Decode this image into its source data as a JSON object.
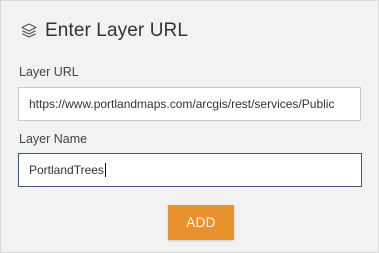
{
  "dialog": {
    "title": "Enter Layer URL",
    "icon": "layers-icon"
  },
  "layer_url": {
    "label": "Layer URL",
    "value": "https://www.portlandmaps.com/arcgis/rest/services/Public"
  },
  "layer_name": {
    "label": "Layer Name",
    "value": "PortlandTrees"
  },
  "actions": {
    "add_label": "ADD"
  },
  "colors": {
    "accent_button": "#e8912e",
    "panel_background": "#f2f2f2",
    "focused_border": "#40597a"
  }
}
